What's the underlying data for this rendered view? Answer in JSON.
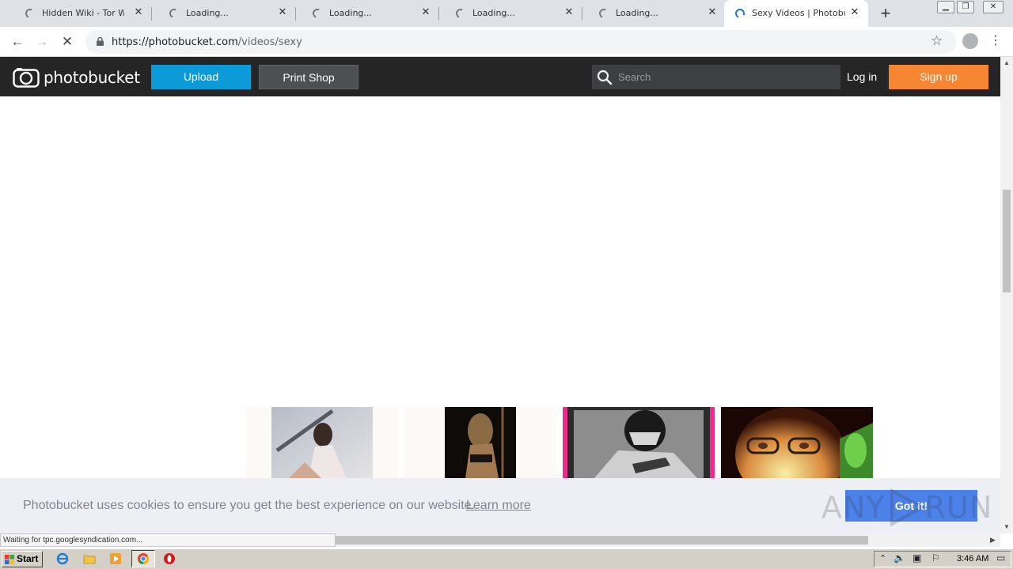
{
  "browser": {
    "tabs": [
      {
        "title": "Hidden Wiki - Tor Wiki - D",
        "loading": false
      },
      {
        "title": "Loading...",
        "loading": true
      },
      {
        "title": "Loading...",
        "loading": true
      },
      {
        "title": "Loading...",
        "loading": true
      },
      {
        "title": "Loading...",
        "loading": true
      },
      {
        "title": "Sexy Videos | Photobucket",
        "loading": true,
        "active": true
      }
    ],
    "new_tab_icon": "plus-icon",
    "window_controls": [
      "minimize",
      "restore",
      "close"
    ],
    "url_host": "https://photobucket.com",
    "url_path": "/videos/sexy",
    "status_text": "Waiting for tpc.googlesyndication.com..."
  },
  "site": {
    "logo_text": "photobucket",
    "upload_label": "Upload",
    "print_shop_label": "Print Shop",
    "search_placeholder": "Search",
    "login_label": "Log in",
    "signup_label": "Sign up",
    "colors": {
      "header_bg": "#252526",
      "upload": "#0c9ad8",
      "print_shop": "#4d4f52",
      "signup": "#f68632",
      "cookie_button": "#4b81e8"
    }
  },
  "thumbnails": [
    {
      "name": "thumb-1"
    },
    {
      "name": "thumb-2"
    },
    {
      "name": "thumb-3"
    },
    {
      "name": "thumb-4"
    }
  ],
  "cookie_bar": {
    "message": "Photobucket uses cookies to ensure you get the best experience on our website.",
    "learn_more": "Learn more",
    "button": "Got it!"
  },
  "watermark": "ANY RUN",
  "taskbar": {
    "start_label": "Start",
    "clock": "3:46 AM"
  }
}
